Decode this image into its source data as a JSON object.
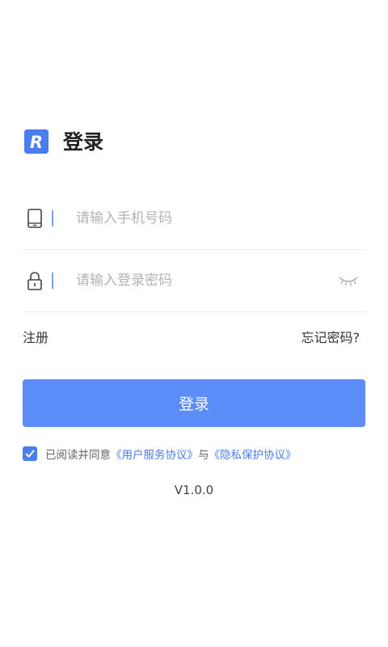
{
  "header": {
    "title": "登录",
    "logo_letter": "R"
  },
  "form": {
    "phone_placeholder": "请输入手机号码",
    "phone_value": "",
    "password_placeholder": "请输入登录密码",
    "password_value": ""
  },
  "links": {
    "register": "注册",
    "forgot_password": "忘记密码?"
  },
  "login_button_label": "登录",
  "agreement": {
    "checked": true,
    "prefix": "已阅读并同意",
    "user_agreement": "《用户服务协议》",
    "conjunction": "与",
    "privacy_policy": "《隐私保护协议》"
  },
  "version": "V1.0.0",
  "colors": {
    "accent": "#4a7ef0",
    "button": "#5b8cf7",
    "placeholder": "#b3b3b3"
  },
  "icons": {
    "logo": "brand-r-logo-icon",
    "phone": "tablet-icon",
    "password": "lock-icon",
    "toggle_visibility": "eye-closed-icon",
    "checkbox": "checkmark-icon"
  }
}
